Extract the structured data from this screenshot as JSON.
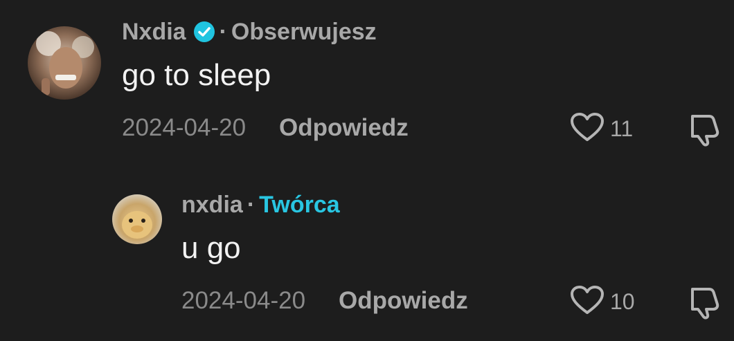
{
  "comments": [
    {
      "author": "Nxdia",
      "separator": "·",
      "relation": "Obserwujesz",
      "text": "go to sleep",
      "date": "2024-04-20",
      "reply_label": "Odpowiedz",
      "likes": "11"
    },
    {
      "author": "nxdia",
      "separator": "·",
      "relation": "Twórca",
      "text": "u go",
      "date": "2024-04-20",
      "reply_label": "Odpowiedz",
      "likes": "10"
    }
  ],
  "colors": {
    "background": "#1d1d1d",
    "verified_badge": "#20c4e0",
    "creator_label": "#29c6e2"
  },
  "icons": {
    "verified": "verified-badge-icon",
    "like": "heart-outline-icon",
    "dislike": "thumbs-down-icon"
  }
}
